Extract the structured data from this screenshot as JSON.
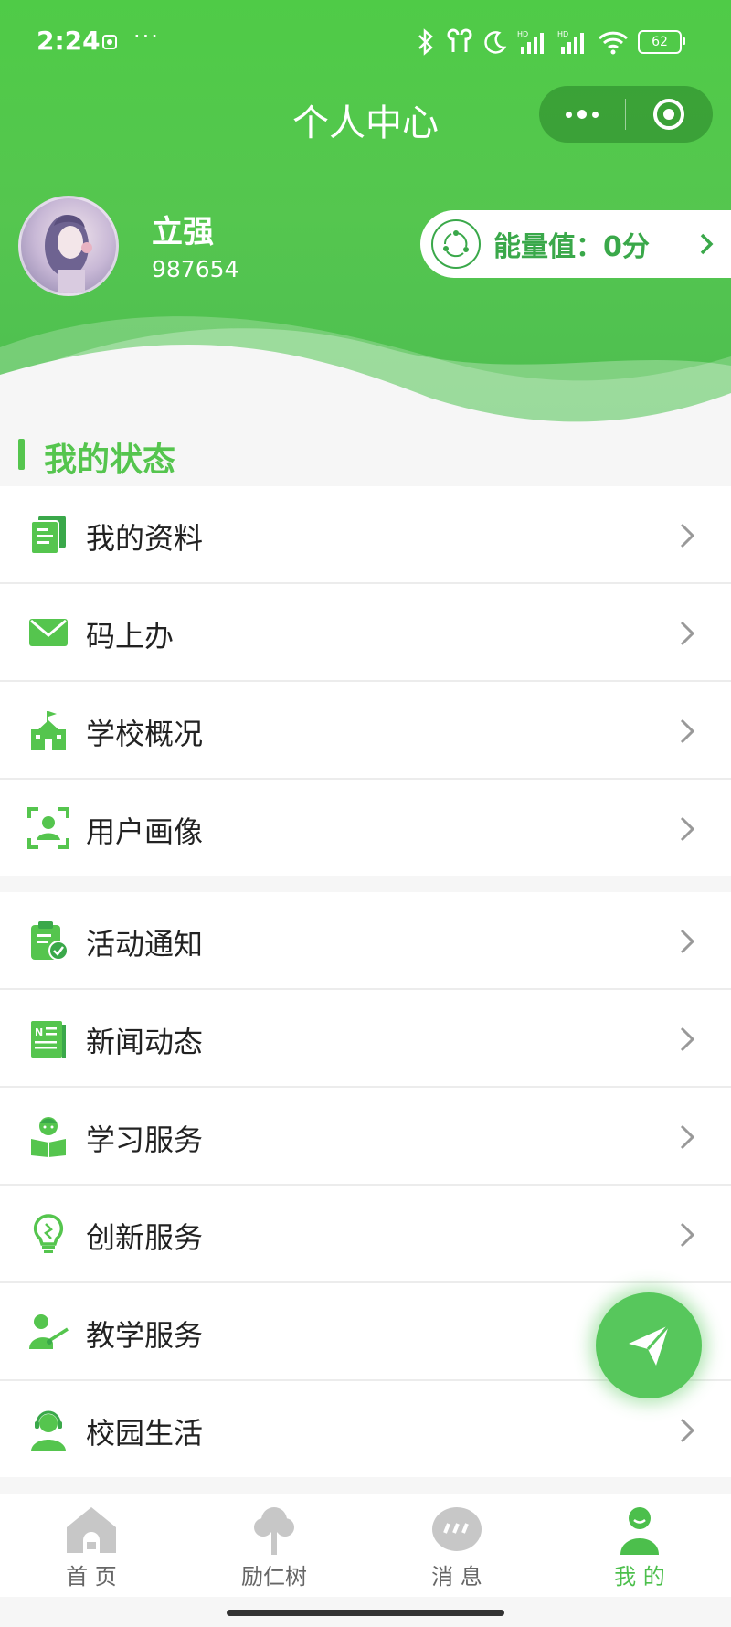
{
  "status_bar": {
    "time": "2:24",
    "battery": "62"
  },
  "header": {
    "title": "个人中心"
  },
  "user": {
    "name": "立强",
    "id": "987654"
  },
  "energy": {
    "label": "能量值：0分"
  },
  "section": {
    "title": "我的状态"
  },
  "group1": [
    {
      "label": "我的资料",
      "icon": "profile-doc-icon"
    },
    {
      "label": "码上办",
      "icon": "envelope-icon"
    },
    {
      "label": "学校概况",
      "icon": "school-building-icon"
    },
    {
      "label": "用户画像",
      "icon": "user-scan-icon"
    }
  ],
  "group2": [
    {
      "label": "活动通知",
      "icon": "clipboard-check-icon"
    },
    {
      "label": "新闻动态",
      "icon": "news-icon"
    },
    {
      "label": "学习服务",
      "icon": "reading-student-icon"
    },
    {
      "label": "创新服务",
      "icon": "lightbulb-icon"
    },
    {
      "label": "教学服务",
      "icon": "teacher-icon"
    },
    {
      "label": "校园生活",
      "icon": "headset-user-icon"
    }
  ],
  "tabs": [
    {
      "label": "首 页",
      "icon": "home-icon"
    },
    {
      "label": "励仁树",
      "icon": "tree-icon"
    },
    {
      "label": "消 息",
      "icon": "message-bubble-icon"
    },
    {
      "label": "我 的",
      "icon": "person-icon",
      "active": true
    }
  ],
  "colors": {
    "brand": "#4fcb47",
    "accent": "#55c54e",
    "energy_text": "#3aa84a"
  }
}
